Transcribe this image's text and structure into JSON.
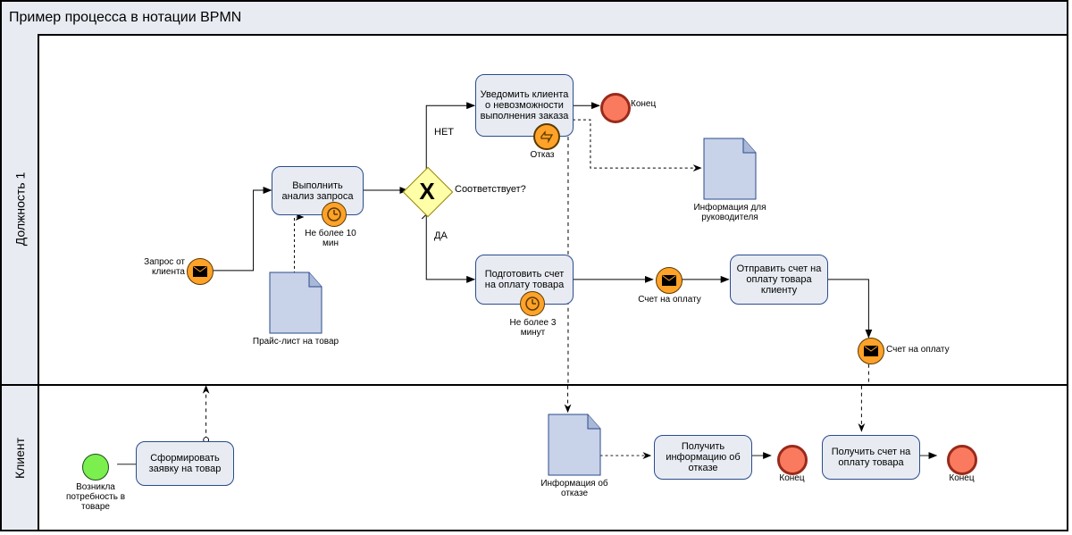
{
  "title": "Пример процесса в нотации BPMN",
  "lanes": {
    "role1": "Должность 1",
    "client": "Клиент"
  },
  "events": {
    "start_label": "Возникла потребность в товаре",
    "msg_request_label": "Запрос от клиента",
    "timer1_label": "Не более 10 мин",
    "timer2_label": "Не более 3 минут",
    "cancel_label": "Отказ",
    "end1_label": "Конец",
    "msg_invoice_label": "Счет на оплату",
    "msg_invoice2_label": "Счет на оплату",
    "end2_label": "Конец",
    "end3_label": "Конец"
  },
  "tasks": {
    "form_request": "Сформировать заявку на товар",
    "analyze": "Выполнить анализ запроса",
    "notify_fail": "Уведомить клиента о невозможности выполнения заказа",
    "prepare_invoice": "Подготовить счет на оплату товара",
    "send_invoice": "Отправить счет на оплату товара клиенту",
    "receive_refusal": "Получить информацию об отказе",
    "receive_invoice": "Получить счет на оплату товара"
  },
  "gateway": {
    "question": "Соответствует?",
    "no": "НЕТ",
    "yes": "ДA"
  },
  "docs": {
    "pricelist": "Прайс-лист на товар",
    "mgr_info": "Информация для руководителя",
    "refusal_info": "Информация об отказе"
  }
}
